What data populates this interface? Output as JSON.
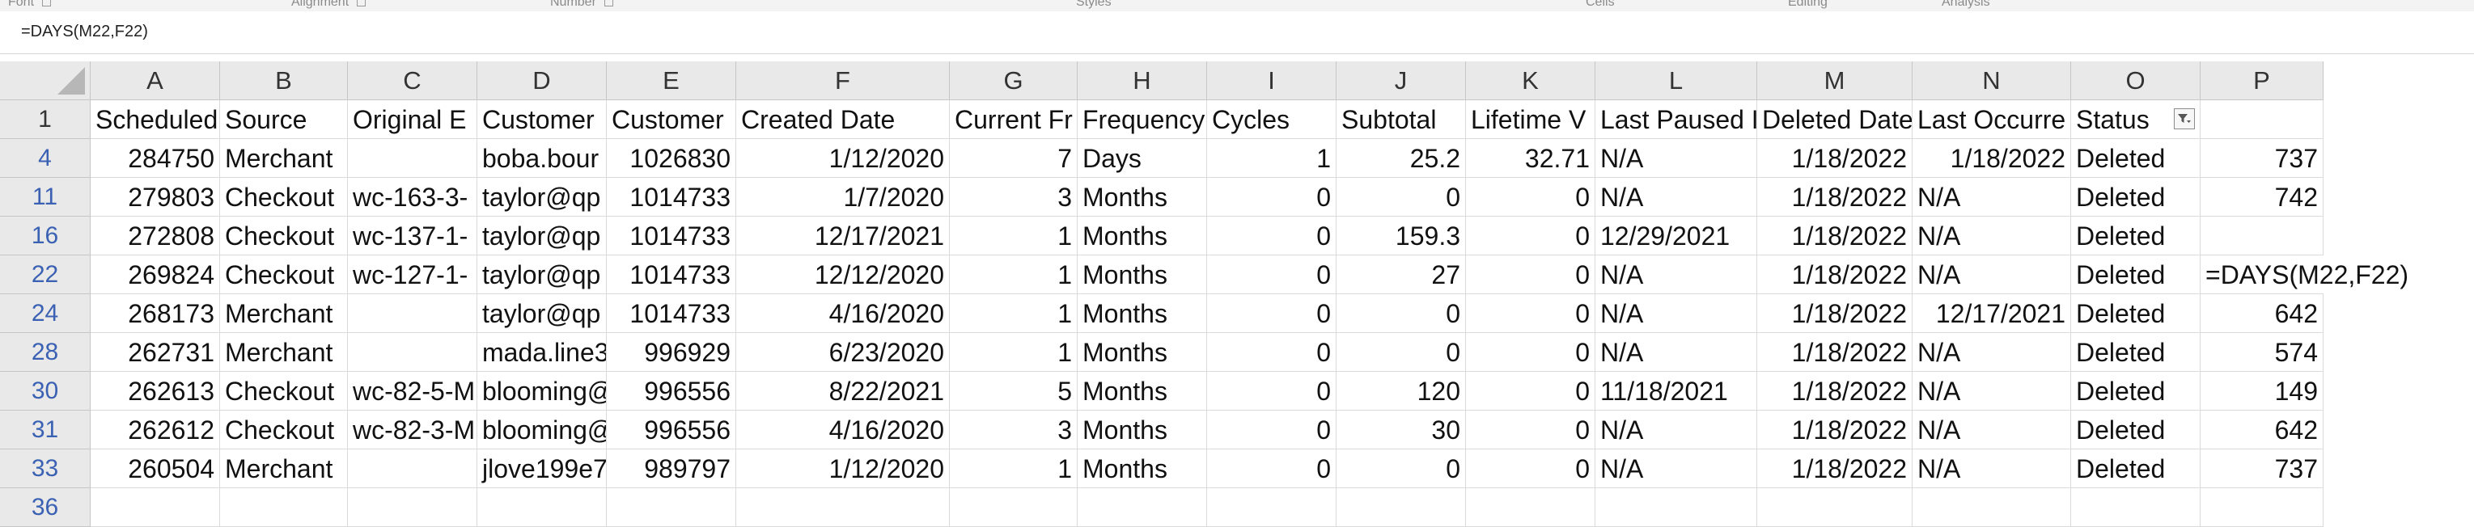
{
  "ribbon": {
    "groups": [
      {
        "label": "Font"
      },
      {
        "label": "Alignment"
      },
      {
        "label": "Number"
      },
      {
        "label": "Styles"
      },
      {
        "label": "Cells"
      },
      {
        "label": "Editing"
      },
      {
        "label": "Analysis"
      }
    ]
  },
  "formula_bar": {
    "value": "=DAYS(M22,F22)"
  },
  "margin_char": "e",
  "columns": [
    {
      "letter": "A"
    },
    {
      "letter": "B"
    },
    {
      "letter": "C"
    },
    {
      "letter": "D"
    },
    {
      "letter": "E"
    },
    {
      "letter": "F"
    },
    {
      "letter": "G"
    },
    {
      "letter": "H"
    },
    {
      "letter": "I"
    },
    {
      "letter": "J"
    },
    {
      "letter": "K"
    },
    {
      "letter": "L"
    },
    {
      "letter": "M"
    },
    {
      "letter": "N"
    },
    {
      "letter": "O"
    },
    {
      "letter": "P"
    }
  ],
  "header_row": {
    "row_number": "1",
    "cells": [
      "Scheduled",
      "Source",
      "Original E",
      "Customer",
      "Customer",
      "Created Date",
      "Current Fr",
      "Frequency",
      "Cycles",
      "Subtotal",
      "Lifetime V",
      "Last Paused I",
      "Deleted Date",
      "Last Occurre",
      "Status",
      ""
    ]
  },
  "rows": [
    {
      "row_number": "4",
      "cells": [
        "284750",
        "Merchant",
        "",
        "boba.bour",
        "1026830",
        "1/12/2020",
        "7",
        "Days",
        "1",
        "25.2",
        "32.71",
        "N/A",
        "1/18/2022",
        "1/18/2022",
        "Deleted",
        "737"
      ]
    },
    {
      "row_number": "11",
      "cells": [
        "279803",
        "Checkout",
        "wc-163-3-",
        "taylor@qp",
        "1014733",
        "1/7/2020",
        "3",
        "Months",
        "0",
        "0",
        "0",
        "N/A",
        "1/18/2022",
        "N/A",
        "Deleted",
        "742"
      ]
    },
    {
      "row_number": "16",
      "cells": [
        "272808",
        "Checkout",
        "wc-137-1-",
        "taylor@qp",
        "1014733",
        "12/17/2021",
        "1",
        "Months",
        "0",
        "159.3",
        "0",
        "12/29/2021",
        "1/18/2022",
        "N/A",
        "Deleted",
        ""
      ]
    },
    {
      "row_number": "22",
      "cells": [
        "269824",
        "Checkout",
        "wc-127-1-",
        "taylor@qp",
        "1014733",
        "12/12/2020",
        "1",
        "Months",
        "0",
        "27",
        "0",
        "N/A",
        "1/18/2022",
        "N/A",
        "Deleted",
        "=DAYS(M22,F22)"
      ]
    },
    {
      "row_number": "24",
      "cells": [
        "268173",
        "Merchant",
        "",
        "taylor@qp",
        "1014733",
        "4/16/2020",
        "1",
        "Months",
        "0",
        "0",
        "0",
        "N/A",
        "1/18/2022",
        "12/17/2021",
        "Deleted",
        "642"
      ]
    },
    {
      "row_number": "28",
      "cells": [
        "262731",
        "Merchant",
        "",
        "mada.line3",
        "996929",
        "6/23/2020",
        "1",
        "Months",
        "0",
        "0",
        "0",
        "N/A",
        "1/18/2022",
        "N/A",
        "Deleted",
        "574"
      ]
    },
    {
      "row_number": "30",
      "cells": [
        "262613",
        "Checkout",
        "wc-82-5-M",
        "blooming@",
        "996556",
        "8/22/2021",
        "5",
        "Months",
        "0",
        "120",
        "0",
        "11/18/2021",
        "1/18/2022",
        "N/A",
        "Deleted",
        "149"
      ]
    },
    {
      "row_number": "31",
      "cells": [
        "262612",
        "Checkout",
        "wc-82-3-M",
        "blooming@",
        "996556",
        "4/16/2020",
        "3",
        "Months",
        "0",
        "30",
        "0",
        "N/A",
        "1/18/2022",
        "N/A",
        "Deleted",
        "642"
      ]
    },
    {
      "row_number": "33",
      "cells": [
        "260504",
        "Merchant",
        "",
        "jlove199e7",
        "989797",
        "1/12/2020",
        "1",
        "Months",
        "0",
        "0",
        "0",
        "N/A",
        "1/18/2022",
        "N/A",
        "Deleted",
        "737"
      ]
    },
    {
      "row_number": "36",
      "cells": [
        "",
        "",
        "",
        "",
        "",
        "",
        "",
        "",
        "",
        "",
        "",
        "",
        "",
        "",
        "",
        ""
      ]
    }
  ],
  "active_filter_column": "O"
}
